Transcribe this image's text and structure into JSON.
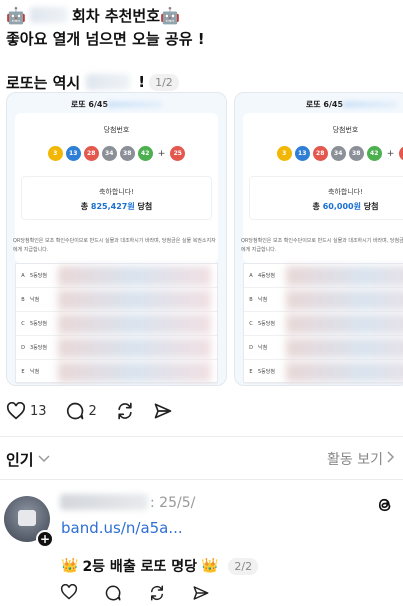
{
  "post": {
    "line1": "회차 추천번호",
    "line2": "좋아요 열개 넘으면 오늘 공유 !",
    "line3_prefix": "로또는 역시",
    "line3_suffix": "!",
    "page_indicator": "1/2"
  },
  "cards": [
    {
      "title": "로또 6/45",
      "win_label": "당첨번호",
      "balls": [
        "3",
        "13",
        "28",
        "34",
        "38",
        "42"
      ],
      "bonus": "25",
      "congrats": "축하합니다!",
      "total_prefix": "총",
      "total_amount": "825,427원",
      "total_suffix": "당첨",
      "notice": "QR당첨확인은 보조 확인수단이므로 반드시 실물과 대조하시기 바라며, 당첨금은 실물 복권소지자에게 지급합니다.",
      "rows": [
        {
          "game": "A",
          "rank": "5등당첨"
        },
        {
          "game": "B",
          "rank": "낙첨"
        },
        {
          "game": "C",
          "rank": "5등당첨"
        },
        {
          "game": "D",
          "rank": "3등당첨"
        },
        {
          "game": "E",
          "rank": "낙첨"
        }
      ]
    },
    {
      "title": "로또 6/45",
      "win_label": "당첨번호",
      "balls": [
        "3",
        "13",
        "28",
        "34",
        "38",
        "42"
      ],
      "bonus": "2",
      "congrats": "축하합니다!",
      "total_prefix": "총",
      "total_amount": "60,000원",
      "total_suffix": "당첨",
      "notice": "QR당첨확인은 보조 확인수단이므로 반드시 실물과 대조하시기 바라며, 당첨금은 실물 복권소지자에게 지급합니다.",
      "rows": [
        {
          "game": "A",
          "rank": "4등당첨"
        },
        {
          "game": "B",
          "rank": "낙첨"
        },
        {
          "game": "C",
          "rank": "5등당첨"
        },
        {
          "game": "D",
          "rank": "낙첨"
        },
        {
          "game": "E",
          "rank": "5등당첨"
        }
      ]
    }
  ],
  "ball_colors": {
    "yellow": "#f2b705",
    "blue": "#2f7fd6",
    "red": "#e4574d",
    "gray": "#8a8f98",
    "green": "#4caf50"
  },
  "actions": {
    "likes": "13",
    "comments": "2"
  },
  "popular": {
    "label": "인기",
    "activity_label": "활동 보기"
  },
  "reply": {
    "date": ": 25/5/",
    "link": "band.us/n/a5a...",
    "text": "2등 배출 로또 명당",
    "page_indicator": "2/2"
  },
  "icons": [
    "robot-emoji-icon",
    "heart-icon",
    "comment-icon",
    "repost-icon",
    "share-icon",
    "chevron-down-icon",
    "chevron-right-icon",
    "threads-icon",
    "crown-icon",
    "plus-icon"
  ]
}
